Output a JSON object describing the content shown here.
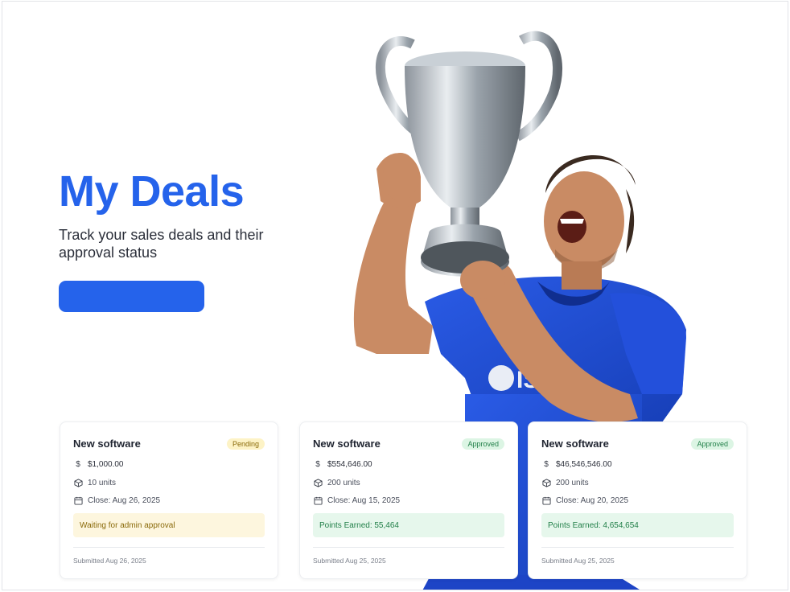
{
  "hero": {
    "title": "My Deals",
    "subtitle": "Track your sales deals and their approval status",
    "button_label": ""
  },
  "icons": {
    "amount": "dollar-icon",
    "units": "box-icon",
    "close": "calendar-icon"
  },
  "cards": [
    {
      "title": "New software",
      "status": "Pending",
      "amount": "$1,000.00",
      "units": "10 units",
      "close": "Close: Aug 26, 2025",
      "note": "Waiting for admin approval",
      "submitted": "Submitted Aug 26, 2025"
    },
    {
      "title": "New software",
      "status": "Approved",
      "amount": "$554,646.00",
      "units": "200 units",
      "close": "Close: Aug 15, 2025",
      "note": "Points Earned: 55,464",
      "submitted": "Submitted Aug 25, 2025"
    },
    {
      "title": "New software",
      "status": "Approved",
      "amount": "$46,546,546.00",
      "units": "200 units",
      "close": "Close: Aug 20, 2025",
      "note": "Points Earned: 4,654,654",
      "submitted": "Submitted Aug 25, 2025"
    }
  ],
  "colors": {
    "accent": "#2563eb",
    "pending_bg": "#fdf3c6",
    "approved_bg": "#dcf5e4",
    "jersey": "#1f4fd6"
  }
}
